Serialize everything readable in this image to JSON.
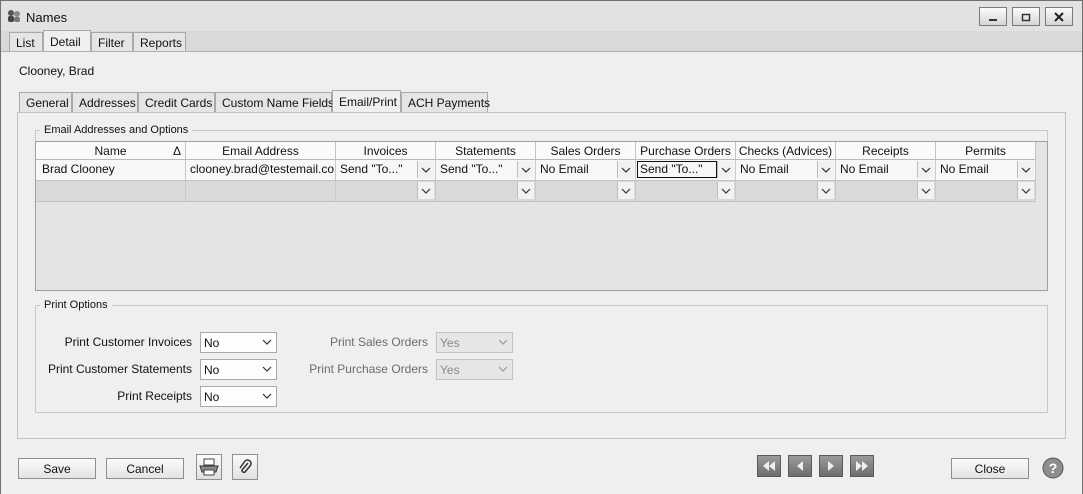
{
  "window": {
    "title": "Names"
  },
  "main_tabs": [
    "List",
    "Detail",
    "Filter",
    "Reports"
  ],
  "record_name": "Clooney, Brad",
  "sub_tabs": [
    "General",
    "Addresses",
    "Credit Cards",
    "Custom Name Fields",
    "Email/Print",
    "ACH Payments"
  ],
  "email_section": {
    "title": "Email Addresses and Options",
    "columns": [
      "Name",
      "Email Address",
      "Invoices",
      "Statements",
      "Sales Orders",
      "Purchase Orders",
      "Checks (Advices)",
      "Receipts",
      "Permits"
    ],
    "sort_indicator": "Δ",
    "rows": [
      [
        "Brad Clooney",
        "clooney.brad@testemail.co",
        "Send \"To...\"",
        "Send \"To...\"",
        "No Email",
        "Send \"To...\"",
        "No Email",
        "No Email",
        "No Email"
      ],
      [
        "",
        "",
        "",
        "",
        "",
        "",
        "",
        "",
        ""
      ]
    ]
  },
  "print_section": {
    "title": "Print Options",
    "print_customer_invoices": {
      "label": "Print Customer Invoices",
      "value": "No"
    },
    "print_customer_statements": {
      "label": "Print Customer Statements",
      "value": "No"
    },
    "print_receipts": {
      "label": "Print Receipts",
      "value": "No"
    },
    "print_sales_orders": {
      "label": "Print Sales Orders",
      "value": "Yes"
    },
    "print_purchase_orders": {
      "label": "Print Purchase Orders",
      "value": "Yes"
    }
  },
  "buttons": {
    "save": "Save",
    "cancel": "Cancel",
    "close": "Close"
  },
  "icons": {
    "app": "names-app-icon",
    "print": "printer-icon",
    "attach": "paperclip-icon",
    "first": "first-record-icon",
    "prev": "previous-record-icon",
    "next": "next-record-icon",
    "last": "last-record-icon",
    "help": "help-icon"
  },
  "colors": {
    "window_bg": "#d9d9d9",
    "panel_bg": "#efefef",
    "nav_button": "#7a7a7a"
  }
}
